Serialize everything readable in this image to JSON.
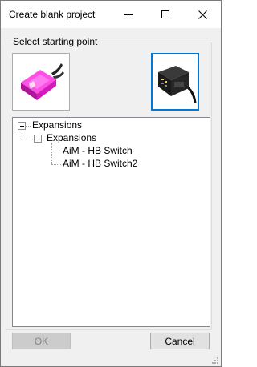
{
  "window": {
    "title": "Create blank project"
  },
  "group": {
    "label": "Select starting point",
    "options": [
      {
        "name": "pink-device",
        "selected": false,
        "icon": "pink-device-icon"
      },
      {
        "name": "black-device",
        "selected": true,
        "icon": "black-device-icon"
      }
    ]
  },
  "tree": {
    "root": "Expansions",
    "child": "Expansions",
    "items": [
      "AiM - HB Switch",
      "AiM - HB Switch2"
    ]
  },
  "buttons": {
    "ok": "OK",
    "cancel": "Cancel"
  },
  "colors": {
    "selection_border": "#0078d7",
    "pink_device": "#e020c8"
  }
}
